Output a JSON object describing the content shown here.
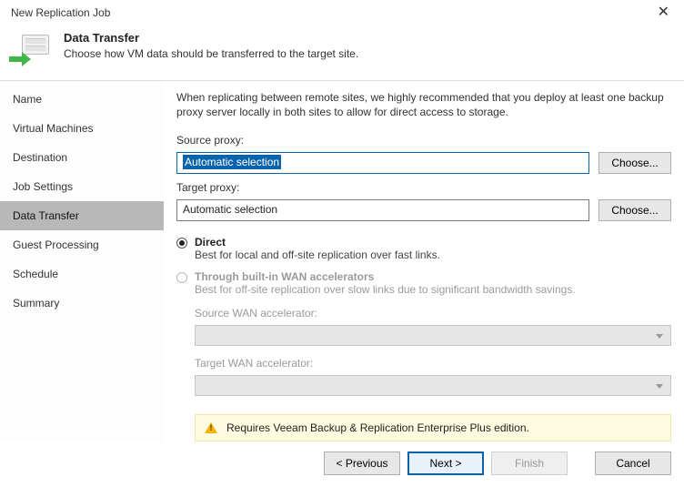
{
  "window": {
    "title": "New Replication Job"
  },
  "header": {
    "title": "Data Transfer",
    "subtitle": "Choose how VM data should be transferred to the target site."
  },
  "sidebar": {
    "items": [
      {
        "label": "Name"
      },
      {
        "label": "Virtual Machines"
      },
      {
        "label": "Destination"
      },
      {
        "label": "Job Settings"
      },
      {
        "label": "Data Transfer",
        "active": true
      },
      {
        "label": "Guest Processing"
      },
      {
        "label": "Schedule"
      },
      {
        "label": "Summary"
      }
    ]
  },
  "main": {
    "intro": "When replicating between remote sites, we highly recommended that you deploy at least one backup proxy server locally in both sites to allow for direct access to storage.",
    "source_proxy_label": "Source proxy:",
    "source_proxy_value": "Automatic selection",
    "target_proxy_label": "Target proxy:",
    "target_proxy_value": "Automatic selection",
    "choose_label": "Choose...",
    "radio_direct_title": "Direct",
    "radio_direct_sub": "Best for local and off-site replication over fast links.",
    "radio_wan_title": "Through built-in WAN accelerators",
    "radio_wan_sub": "Best for off-site replication over slow links due to significant bandwidth savings.",
    "source_wan_label": "Source WAN accelerator:",
    "target_wan_label": "Target WAN accelerator:",
    "notice": "Requires Veeam Backup & Replication Enterprise Plus edition."
  },
  "footer": {
    "previous": "< Previous",
    "next": "Next >",
    "finish": "Finish",
    "cancel": "Cancel"
  }
}
